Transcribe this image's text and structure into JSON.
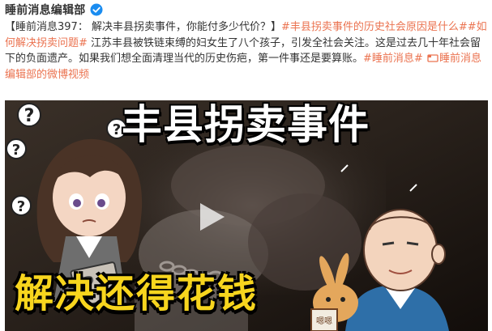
{
  "author": {
    "name": "睡前消息编辑部",
    "badge": "verified-icon"
  },
  "post": {
    "intro": "【睡前消息397： 解决丰县拐卖事件，你能付多少代价？】",
    "tag1": "#丰县拐卖事件的历史社会原因是什么#",
    "tag2": "#如何解决拐卖问题#",
    "body": " 江苏丰县被铁链束缚的妇女生了八个孩子，引发全社会关注。这是过去几十年社会留下的负面遗产。如果我们想全面清理当代的历史伤疤，第一件事还是要算账。",
    "tag3": "#睡前消息#",
    "video_link": "睡前消息编辑部的微博视频"
  },
  "video": {
    "title_top": "丰县拐卖事件",
    "title_bottom": "解决还得花钱",
    "question_marks": [
      "?",
      "?",
      "?",
      "?"
    ],
    "paper_mark": "?",
    "book_text": "嗯嗯"
  },
  "colors": {
    "link": "#eb7350",
    "title_yellow": "#f7d51e",
    "verified_blue": "#1a8cf0"
  }
}
